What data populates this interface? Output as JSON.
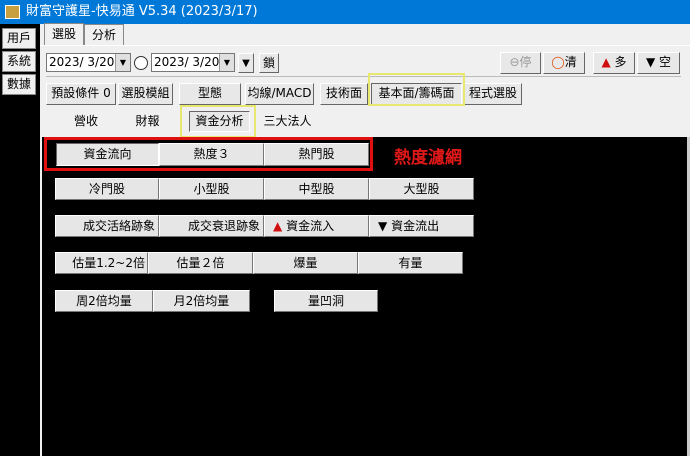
{
  "title": "財富守護星-快易通 V5.34 (2023/3/17)",
  "left_menu": [
    "用戶",
    "系統",
    "數據"
  ],
  "tabs": [
    "選股",
    "分析"
  ],
  "toolbar": {
    "date_from": "2023/ 3/20",
    "date_to": "2023/ 3/20",
    "lock": "鎖",
    "stop": "停",
    "clear": "清",
    "long": "多",
    "short": "空"
  },
  "categories": [
    "預設條件 0",
    "選股模組",
    "型態",
    "均線/MACD",
    "技術面",
    "基本面/籌碼面",
    "程式選股"
  ],
  "subtabs": [
    "營收",
    "財報",
    "資金分析",
    "三大法人"
  ],
  "heat_label": "熱度濾網",
  "rows": [
    [
      "資金流向",
      "熱度３",
      "熱門股"
    ],
    [
      "冷門股",
      "小型股",
      "中型股",
      "大型股"
    ],
    [
      "成交活絡跡象",
      "成交衰退跡象",
      "資金流入",
      "資金流出"
    ],
    [
      "估量1.2~2倍",
      "估量２倍",
      "爆量",
      "有量"
    ],
    [
      "周2倍均量",
      "月2倍均量",
      "量凹洞"
    ]
  ]
}
